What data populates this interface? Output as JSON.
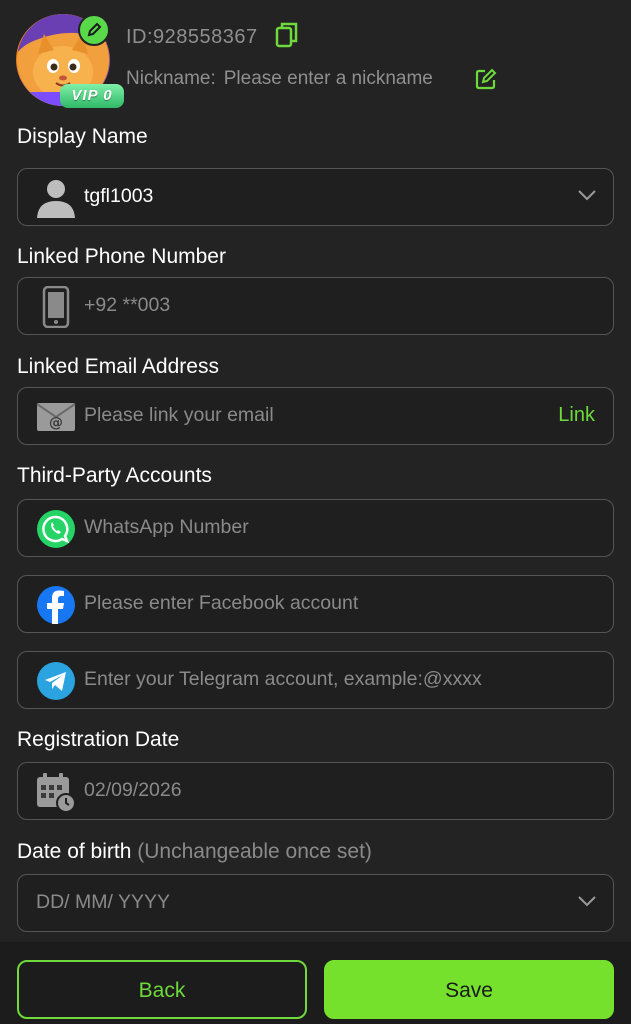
{
  "profile": {
    "user_id": "ID:928558367",
    "vip_label": "VIP 0",
    "nickname_label": "Nickname:",
    "nickname_placeholder": "Please enter a nickname"
  },
  "display_name": {
    "label": "Display Name",
    "value": "tgfl1003"
  },
  "phone": {
    "label": "Linked Phone Number",
    "value": "+92 **003"
  },
  "email": {
    "label": "Linked Email Address",
    "placeholder": "Please link your email",
    "link_label": "Link"
  },
  "third_party": {
    "label": "Third-Party Accounts",
    "whatsapp_placeholder": "WhatsApp Number",
    "facebook_placeholder": "Please enter Facebook account",
    "telegram_placeholder": "Enter your Telegram account, example:@xxxx"
  },
  "registration": {
    "label": "Registration Date",
    "value": "02/09/2026"
  },
  "dob": {
    "label": "Date of birth",
    "hint": "(Unchangeable once set)",
    "placeholder": "DD/ MM/ YYYY"
  },
  "footer": {
    "back_label": "Back",
    "save_label": "Save"
  },
  "colors": {
    "accent": "#6dd93a",
    "save_bg": "#75e12c",
    "background": "#232323",
    "field_border": "#555555"
  },
  "icons": [
    "edit-avatar-icon",
    "copy-icon",
    "edit-icon",
    "user-icon",
    "chevron-down-icon",
    "phone-icon",
    "email-icon",
    "whatsapp-icon",
    "facebook-icon",
    "telegram-icon",
    "calendar-icon"
  ]
}
